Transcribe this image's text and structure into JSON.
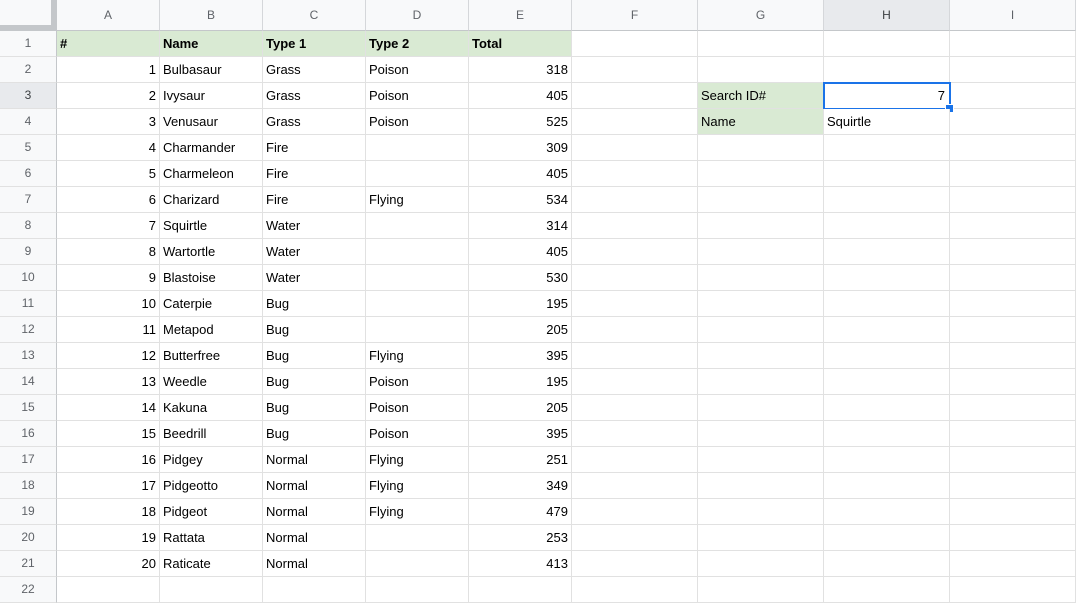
{
  "sheet": {
    "columns": [
      "A",
      "B",
      "C",
      "D",
      "E",
      "F",
      "G",
      "H",
      "I"
    ],
    "row_numbers": [
      "1",
      "2",
      "3",
      "4",
      "5",
      "6",
      "7",
      "8",
      "9",
      "10",
      "11",
      "12",
      "13",
      "14",
      "15",
      "16",
      "17",
      "18",
      "19",
      "20",
      "21",
      "22"
    ],
    "header_row": [
      "#",
      "Name",
      "Type 1",
      "Type 2",
      "Total"
    ],
    "records": [
      {
        "id": "1",
        "name": "Bulbasaur",
        "type1": "Grass",
        "type2": "Poison",
        "total": "318"
      },
      {
        "id": "2",
        "name": "Ivysaur",
        "type1": "Grass",
        "type2": "Poison",
        "total": "405"
      },
      {
        "id": "3",
        "name": "Venusaur",
        "type1": "Grass",
        "type2": "Poison",
        "total": "525"
      },
      {
        "id": "4",
        "name": "Charmander",
        "type1": "Fire",
        "type2": "",
        "total": "309"
      },
      {
        "id": "5",
        "name": "Charmeleon",
        "type1": "Fire",
        "type2": "",
        "total": "405"
      },
      {
        "id": "6",
        "name": "Charizard",
        "type1": "Fire",
        "type2": "Flying",
        "total": "534"
      },
      {
        "id": "7",
        "name": "Squirtle",
        "type1": "Water",
        "type2": "",
        "total": "314"
      },
      {
        "id": "8",
        "name": "Wartortle",
        "type1": "Water",
        "type2": "",
        "total": "405"
      },
      {
        "id": "9",
        "name": "Blastoise",
        "type1": "Water",
        "type2": "",
        "total": "530"
      },
      {
        "id": "10",
        "name": "Caterpie",
        "type1": "Bug",
        "type2": "",
        "total": "195"
      },
      {
        "id": "11",
        "name": "Metapod",
        "type1": "Bug",
        "type2": "",
        "total": "205"
      },
      {
        "id": "12",
        "name": "Butterfree",
        "type1": "Bug",
        "type2": "Flying",
        "total": "395"
      },
      {
        "id": "13",
        "name": "Weedle",
        "type1": "Bug",
        "type2": "Poison",
        "total": "195"
      },
      {
        "id": "14",
        "name": "Kakuna",
        "type1": "Bug",
        "type2": "Poison",
        "total": "205"
      },
      {
        "id": "15",
        "name": "Beedrill",
        "type1": "Bug",
        "type2": "Poison",
        "total": "395"
      },
      {
        "id": "16",
        "name": "Pidgey",
        "type1": "Normal",
        "type2": "Flying",
        "total": "251"
      },
      {
        "id": "17",
        "name": "Pidgeotto",
        "type1": "Normal",
        "type2": "Flying",
        "total": "349"
      },
      {
        "id": "18",
        "name": "Pidgeot",
        "type1": "Normal",
        "type2": "Flying",
        "total": "479"
      },
      {
        "id": "19",
        "name": "Rattata",
        "type1": "Normal",
        "type2": "",
        "total": "253"
      },
      {
        "id": "20",
        "name": "Raticate",
        "type1": "Normal",
        "type2": "",
        "total": "413"
      }
    ],
    "lookup": {
      "id_label": "Search ID#",
      "id_value": "7",
      "name_label": "Name",
      "name_value": "Squirtle"
    },
    "colors": {
      "header_fill_green": "#d9ead3",
      "selection_blue": "#1a73e8",
      "header_bg": "#f8f9fa",
      "header_active_bg": "#e8eaed",
      "gridline": "#e1e1e1"
    }
  }
}
